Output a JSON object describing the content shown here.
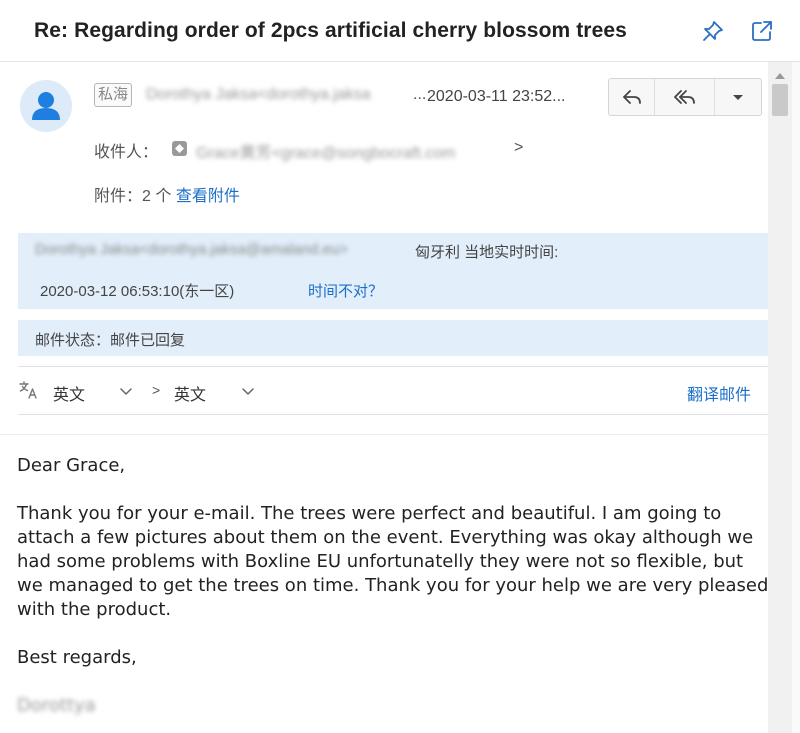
{
  "header": {
    "subject": "Re: Regarding order of 2pcs artificial cherry blossom trees",
    "pin_icon": "pin-icon",
    "open_new_window_icon": "open-new-window-icon"
  },
  "message": {
    "tag": "私海",
    "sender": "Dorothya Jaksa<dorothya.jaksa",
    "sender_ellipsis": "...",
    "date": "2020-03-11 23:52...",
    "actions": {
      "reply_icon": "reply-icon",
      "reply_all_icon": "reply-all-icon",
      "more_icon": "caret-down-icon"
    },
    "recipients_label": "收件人：",
    "recipient": "Grace黄芳<grace@songbocraft.com",
    "recipient_end": ">",
    "attachments_label": "附件：2 个",
    "attachments_link": "查看附件"
  },
  "local_time_box": {
    "sender_email": "Dorothya Jaksa<dorothya.jaksa@amaland.eu>",
    "country_line": "匈牙利 当地实时时间:",
    "local_time": "2020-03-12 06:53:10(东一区)",
    "wrong_time_link": "时间不对？"
  },
  "status_box": {
    "text": "邮件状态：邮件已回复"
  },
  "translate_bar": {
    "icon": "translate-icon",
    "from_lang": "英文",
    "arrow": ">",
    "to_lang": "英文",
    "translate_link": "翻译邮件"
  },
  "body": {
    "greeting": "Dear Grace,",
    "paragraph": "Thank you for your e-mail. The trees were perfect and beautiful. I am going to attach a few pictures about them on the event. Everything was okay although we had some problems with Boxline EU unfortunatelly they were not so flexible, but we managed to get the trees on time. Thank you for your help we are very pleased with the product.",
    "closing": "Best regards,",
    "signature": "Dorottya"
  },
  "colors": {
    "link": "#1c6fc9",
    "info_background": "#e2eefa",
    "avatar_icon": "#1f7fe0"
  }
}
